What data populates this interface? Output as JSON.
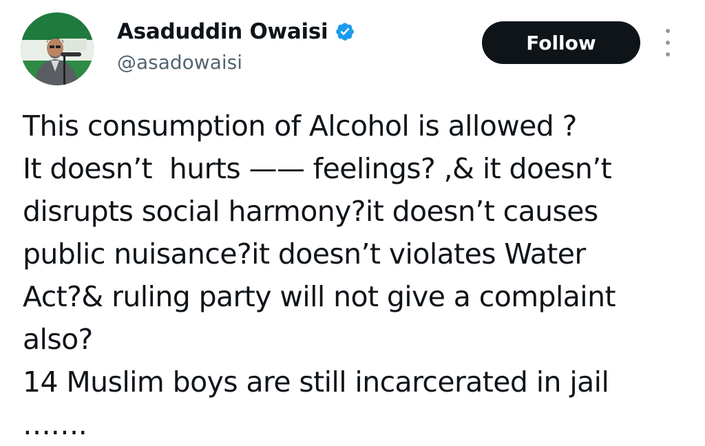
{
  "author": {
    "display_name": "Asaduddin Owaisi",
    "handle": "@asadowaisi",
    "verified_icon": "verified-badge-icon",
    "avatar_icon": "profile-photo"
  },
  "actions": {
    "follow_label": "Follow",
    "more_icon": "more-vertical-icon"
  },
  "tweet": {
    "lines": [
      "This consumption of Alcohol is allowed ?",
      "It doesn’t  hurts —— feelings? ,& it doesn’t",
      "disrupts social harmony?it doesn’t causes",
      "public nuisance?it doesn’t violates Water",
      "Act?& ruling party will not give a complaint",
      "also?",
      "14 Muslim boys are still incarcerated in jail",
      "……."
    ]
  },
  "colors": {
    "text": "#0f1419",
    "secondary_text": "#536471",
    "button_bg": "#0f1419",
    "verified": "#1d9bf0"
  }
}
